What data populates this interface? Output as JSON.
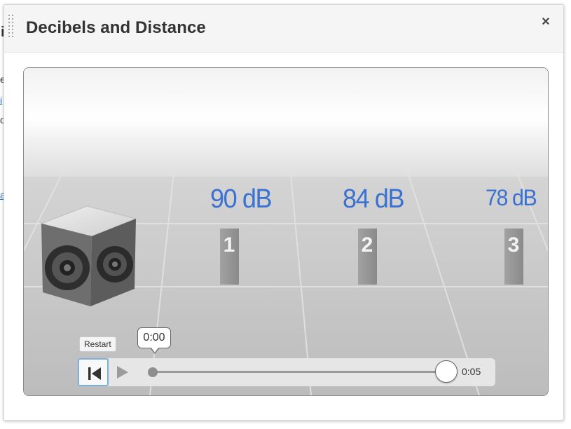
{
  "background": {
    "fragments": [
      "i",
      "e",
      "i",
      "ov",
      "a"
    ]
  },
  "dialog": {
    "title": "Decibels and Distance",
    "close_label": "×"
  },
  "scene": {
    "speaker_icon": "speaker-icon",
    "positions": [
      {
        "number": "1",
        "level": "90 dB"
      },
      {
        "number": "2",
        "level": "84 dB"
      },
      {
        "number": "3",
        "level": "78 dB"
      }
    ],
    "colors": {
      "level_text": "#3b72d1",
      "post": "#8f8f8f",
      "floor": "#c8c8c8"
    }
  },
  "player": {
    "restart_tooltip": "Restart",
    "current_time": "0:00",
    "end_time": "0:05",
    "restart_icon": "skip-back-icon",
    "play_icon": "play-icon",
    "progress": 0,
    "accent": "#79b0dd"
  }
}
